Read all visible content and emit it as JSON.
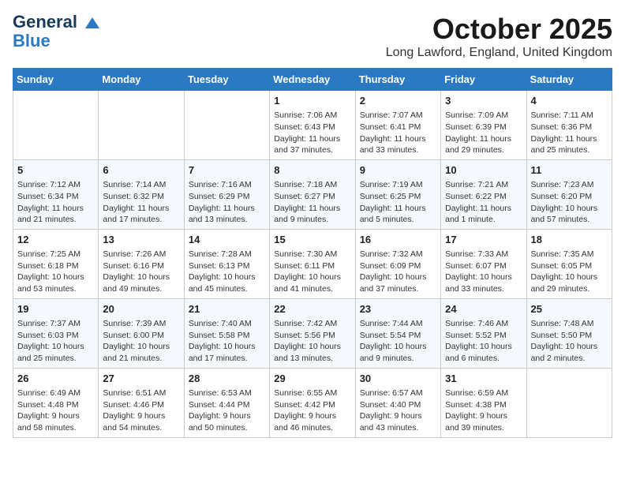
{
  "header": {
    "logo_line1": "General",
    "logo_line2": "Blue",
    "month": "October 2025",
    "location": "Long Lawford, England, United Kingdom"
  },
  "days_of_week": [
    "Sunday",
    "Monday",
    "Tuesday",
    "Wednesday",
    "Thursday",
    "Friday",
    "Saturday"
  ],
  "weeks": [
    [
      {
        "day": "",
        "info": ""
      },
      {
        "day": "",
        "info": ""
      },
      {
        "day": "",
        "info": ""
      },
      {
        "day": "1",
        "info": "Sunrise: 7:06 AM\nSunset: 6:43 PM\nDaylight: 11 hours\nand 37 minutes."
      },
      {
        "day": "2",
        "info": "Sunrise: 7:07 AM\nSunset: 6:41 PM\nDaylight: 11 hours\nand 33 minutes."
      },
      {
        "day": "3",
        "info": "Sunrise: 7:09 AM\nSunset: 6:39 PM\nDaylight: 11 hours\nand 29 minutes."
      },
      {
        "day": "4",
        "info": "Sunrise: 7:11 AM\nSunset: 6:36 PM\nDaylight: 11 hours\nand 25 minutes."
      }
    ],
    [
      {
        "day": "5",
        "info": "Sunrise: 7:12 AM\nSunset: 6:34 PM\nDaylight: 11 hours\nand 21 minutes."
      },
      {
        "day": "6",
        "info": "Sunrise: 7:14 AM\nSunset: 6:32 PM\nDaylight: 11 hours\nand 17 minutes."
      },
      {
        "day": "7",
        "info": "Sunrise: 7:16 AM\nSunset: 6:29 PM\nDaylight: 11 hours\nand 13 minutes."
      },
      {
        "day": "8",
        "info": "Sunrise: 7:18 AM\nSunset: 6:27 PM\nDaylight: 11 hours\nand 9 minutes."
      },
      {
        "day": "9",
        "info": "Sunrise: 7:19 AM\nSunset: 6:25 PM\nDaylight: 11 hours\nand 5 minutes."
      },
      {
        "day": "10",
        "info": "Sunrise: 7:21 AM\nSunset: 6:22 PM\nDaylight: 11 hours\nand 1 minute."
      },
      {
        "day": "11",
        "info": "Sunrise: 7:23 AM\nSunset: 6:20 PM\nDaylight: 10 hours\nand 57 minutes."
      }
    ],
    [
      {
        "day": "12",
        "info": "Sunrise: 7:25 AM\nSunset: 6:18 PM\nDaylight: 10 hours\nand 53 minutes."
      },
      {
        "day": "13",
        "info": "Sunrise: 7:26 AM\nSunset: 6:16 PM\nDaylight: 10 hours\nand 49 minutes."
      },
      {
        "day": "14",
        "info": "Sunrise: 7:28 AM\nSunset: 6:13 PM\nDaylight: 10 hours\nand 45 minutes."
      },
      {
        "day": "15",
        "info": "Sunrise: 7:30 AM\nSunset: 6:11 PM\nDaylight: 10 hours\nand 41 minutes."
      },
      {
        "day": "16",
        "info": "Sunrise: 7:32 AM\nSunset: 6:09 PM\nDaylight: 10 hours\nand 37 minutes."
      },
      {
        "day": "17",
        "info": "Sunrise: 7:33 AM\nSunset: 6:07 PM\nDaylight: 10 hours\nand 33 minutes."
      },
      {
        "day": "18",
        "info": "Sunrise: 7:35 AM\nSunset: 6:05 PM\nDaylight: 10 hours\nand 29 minutes."
      }
    ],
    [
      {
        "day": "19",
        "info": "Sunrise: 7:37 AM\nSunset: 6:03 PM\nDaylight: 10 hours\nand 25 minutes."
      },
      {
        "day": "20",
        "info": "Sunrise: 7:39 AM\nSunset: 6:00 PM\nDaylight: 10 hours\nand 21 minutes."
      },
      {
        "day": "21",
        "info": "Sunrise: 7:40 AM\nSunset: 5:58 PM\nDaylight: 10 hours\nand 17 minutes."
      },
      {
        "day": "22",
        "info": "Sunrise: 7:42 AM\nSunset: 5:56 PM\nDaylight: 10 hours\nand 13 minutes."
      },
      {
        "day": "23",
        "info": "Sunrise: 7:44 AM\nSunset: 5:54 PM\nDaylight: 10 hours\nand 9 minutes."
      },
      {
        "day": "24",
        "info": "Sunrise: 7:46 AM\nSunset: 5:52 PM\nDaylight: 10 hours\nand 6 minutes."
      },
      {
        "day": "25",
        "info": "Sunrise: 7:48 AM\nSunset: 5:50 PM\nDaylight: 10 hours\nand 2 minutes."
      }
    ],
    [
      {
        "day": "26",
        "info": "Sunrise: 6:49 AM\nSunset: 4:48 PM\nDaylight: 9 hours\nand 58 minutes."
      },
      {
        "day": "27",
        "info": "Sunrise: 6:51 AM\nSunset: 4:46 PM\nDaylight: 9 hours\nand 54 minutes."
      },
      {
        "day": "28",
        "info": "Sunrise: 6:53 AM\nSunset: 4:44 PM\nDaylight: 9 hours\nand 50 minutes."
      },
      {
        "day": "29",
        "info": "Sunrise: 6:55 AM\nSunset: 4:42 PM\nDaylight: 9 hours\nand 46 minutes."
      },
      {
        "day": "30",
        "info": "Sunrise: 6:57 AM\nSunset: 4:40 PM\nDaylight: 9 hours\nand 43 minutes."
      },
      {
        "day": "31",
        "info": "Sunrise: 6:59 AM\nSunset: 4:38 PM\nDaylight: 9 hours\nand 39 minutes."
      },
      {
        "day": "",
        "info": ""
      }
    ]
  ]
}
